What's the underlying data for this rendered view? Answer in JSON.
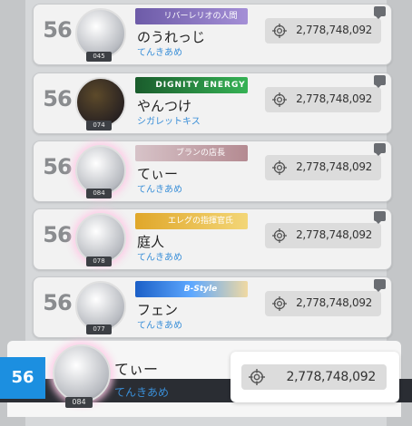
{
  "ranking": {
    "rows": [
      {
        "rank": "56",
        "level": "045",
        "banner": "リバーレリオの人間",
        "banner_style": "purple",
        "name": "のうれっじ",
        "guild": "てんきあめ",
        "score": "2,778,748,092",
        "avatar": "light"
      },
      {
        "rank": "56",
        "level": "074",
        "banner": "DIGNITY ENERGY",
        "banner_style": "green",
        "name": "やんつけ",
        "guild": "シガレットキス",
        "score": "2,778,748,092",
        "avatar": "dark"
      },
      {
        "rank": "56",
        "level": "084",
        "banner": "ブランの店長",
        "banner_style": "pink",
        "name": "てぃー",
        "guild": "てんきあめ",
        "score": "2,778,748,092",
        "avatar": "glow"
      },
      {
        "rank": "56",
        "level": "078",
        "banner": "エレグの指揮官氏",
        "banner_style": "gold",
        "name": "庭人",
        "guild": "てんきあめ",
        "score": "2,778,748,092",
        "avatar": "glow"
      },
      {
        "rank": "56",
        "level": "077",
        "banner": "B-Style",
        "banner_style": "blue",
        "name": "フェン",
        "guild": "てんきあめ",
        "score": "2,778,748,092",
        "avatar": "light"
      }
    ]
  },
  "me": {
    "rank": "56",
    "level": "084",
    "name": "てぃー",
    "guild": "てんきあめ",
    "score": "2,778,748,092"
  },
  "icons": {
    "score": "crosshair-icon",
    "chat": "chat-bubble-icon"
  },
  "colors": {
    "rank_highlight": "#1c8fe0",
    "guild": "#3a8fd8"
  }
}
